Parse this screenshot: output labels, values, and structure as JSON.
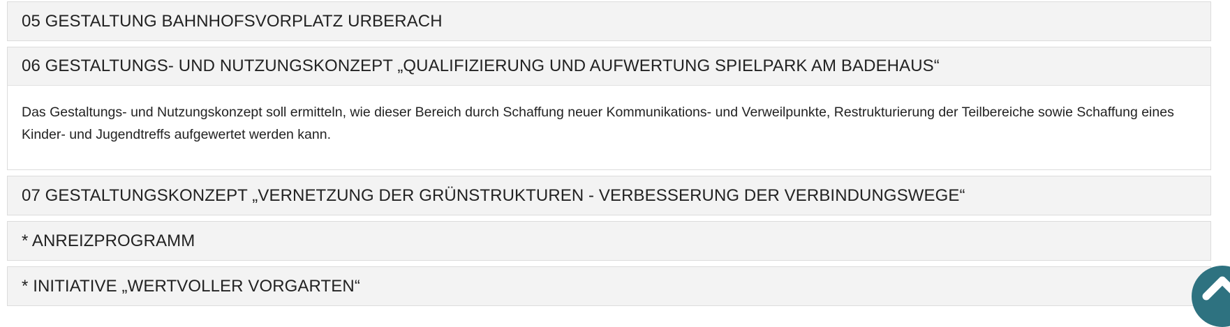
{
  "accordion": {
    "items": [
      {
        "title": "05 GESTALTUNG BAHNHOFSVORPLATZ URBERACH"
      },
      {
        "title": "06 GESTALTUNGS- UND NUTZUNGSKONZEPT „QUALIFIZIERUNG UND AUFWERTUNG SPIELPARK AM BADEHAUS“",
        "body": "Das Gestaltungs- und Nutzungskonzept soll ermitteln, wie dieser Bereich durch Schaffung neuer Kommunikations- und Verweilpunkte, Restrukturierung der Teilbereiche sowie Schaffung eines Kinder- und Jugendtreffs aufgewertet werden kann."
      },
      {
        "title": "07 GESTALTUNGSKONZEPT „VERNETZUNG DER GRÜNSTRUKTUREN - VERBESSERUNG DER VERBINDUNGSWEGE“"
      },
      {
        "title": "* ANREIZPROGRAMM"
      },
      {
        "title": "* INITIATIVE „WERTVOLLER VORGARTEN“"
      }
    ]
  },
  "scroll_top": {
    "icon": "chevron-up-icon",
    "color": "#2e7280"
  }
}
